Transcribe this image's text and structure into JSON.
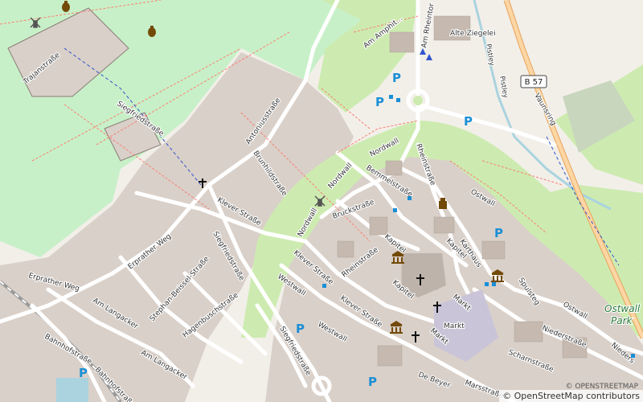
{
  "streets": {
    "alte_ziegelei": "Alte Ziegelei",
    "am_rheintor": "Am Rheintor",
    "am_amphitheater": "Am Amphit...",
    "trajanstrasse": "Trajanstraße",
    "siegfriedstrasse": "Siegfriedstraße",
    "antoniusstrasse": "Antoniusstraße",
    "brunhildstrasse": "Brunhildstraße",
    "nordwall": "Nordwall",
    "rheinstrasse": "Rheinstraße",
    "bemmelstrasse": "Bemmelstraße",
    "klever_strasse": "Klever Straße",
    "bruckstrasse": "Bruckstraße",
    "kapitel": "Kapitel",
    "ostwall": "Ostwall",
    "karthaus": "Karthaus",
    "erprather_weg": "Erprather Weg",
    "am_langacker": "Am Langacker",
    "stephan_beissel_strasse": "Stephan-Beissel-Straße",
    "hagenbuschstrasse": "Hagenbuschstraße",
    "westwall": "Westwall",
    "markt": "Markt",
    "spulsteg": "Spulsteg",
    "niederstrasse": "Niederstraße",
    "scharnstrasse": "Scharnstraße",
    "bahnhofstrasse": "Bahnhofstraße",
    "de_beyer": "De Beyer",
    "marsstrasse": "Marsstraße",
    "vaunsring": "Vaunsring",
    "pistley": "Pistley",
    "nieders_trunc": "Nieders"
  },
  "road_shield": "B 57",
  "park_label": "Ostwall Park",
  "parking_symbol": "P",
  "attribution": {
    "prefix": "© ",
    "osm": "OpenStreetMap",
    "suffix": " contributors",
    "secondary": "© OPENSTREETMAP"
  },
  "colors": {
    "background": "#f2efe9",
    "residential": "#d9d0c9",
    "park": "#c8f0c8",
    "grass": "#cdebb0",
    "water": "#aad3df",
    "road": "#ffffff",
    "trunk": "#fcd6a4",
    "path": "#fa8072",
    "parking": "#1a8fd6"
  }
}
